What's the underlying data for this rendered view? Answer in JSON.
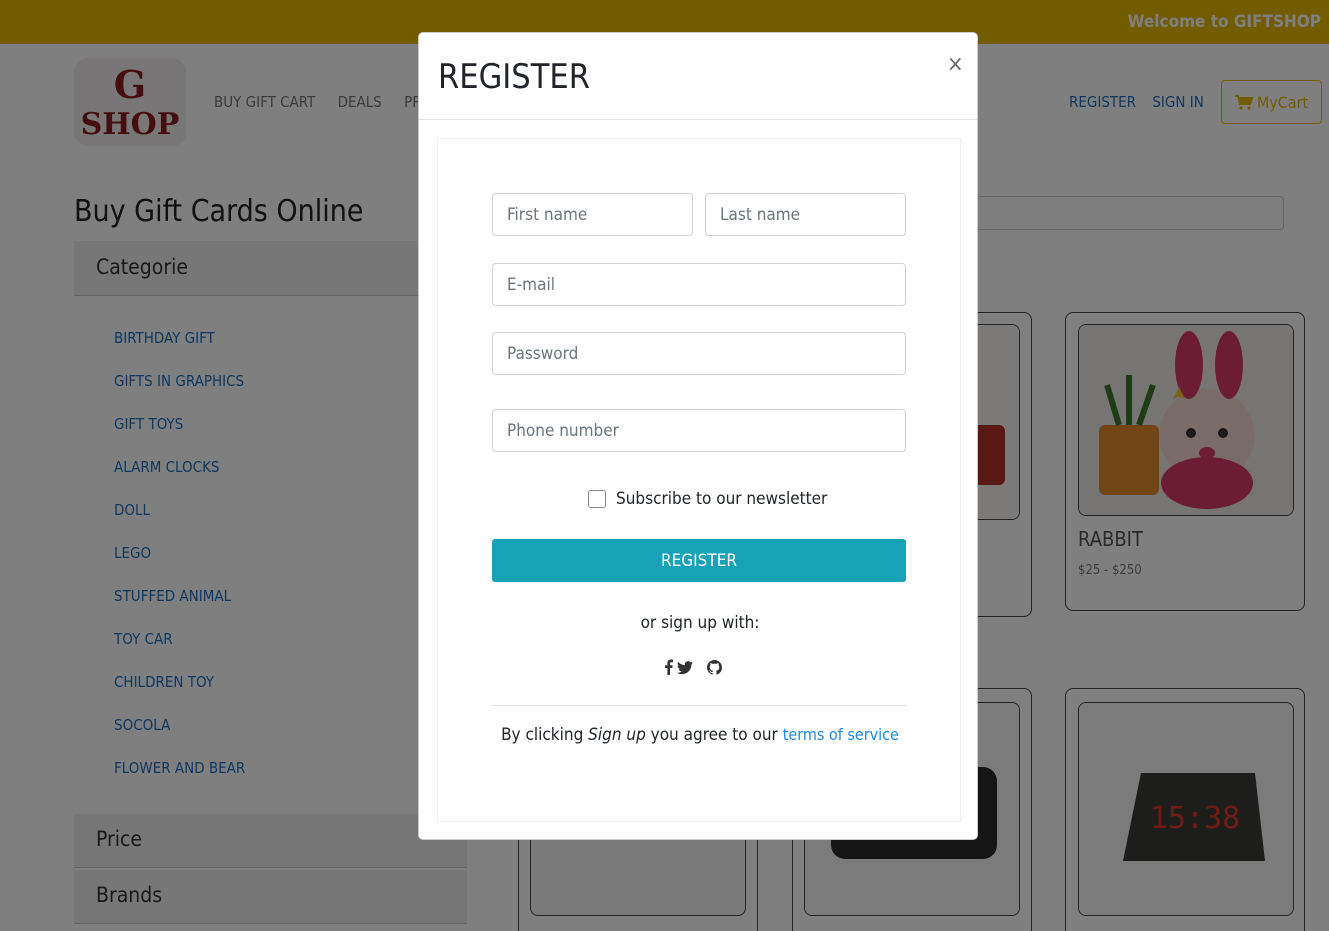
{
  "banner": {
    "welcome": "Welcome to GIFTSHOP"
  },
  "header": {
    "logo_text_top": "G",
    "logo_text_bottom": "SHOP",
    "nav": [
      "BUY GIFT CART",
      "DEALS",
      "PRO"
    ],
    "register": "REGISTER",
    "signin": "SIGN IN",
    "cart": "MyCart"
  },
  "page": {
    "title": "Buy Gift Cards Online",
    "category_header": "Categorie",
    "categories": [
      "BIRTHDAY GIFT",
      "GIFTS IN GRAPHICS",
      "GIFT TOYS",
      "ALARM CLOCKS",
      "DOLL",
      "LEGO",
      "STUFFED ANIMAL",
      "TOY CAR",
      "CHILDREN TOY",
      "SOCOLA",
      "FLOWER AND BEAR"
    ],
    "price_header": "Price",
    "brands_header": "Brands",
    "products": [
      {
        "name": "RABBIT",
        "price": "$25 - $250"
      }
    ]
  },
  "modal": {
    "title": "REGISTER",
    "close": "×",
    "first_name_placeholder": "First name",
    "last_name_placeholder": "Last name",
    "email_placeholder": "E-mail",
    "password_placeholder": "Password",
    "phone_placeholder": "Phone number",
    "newsletter_label": "Subscribe to our newsletter",
    "register_button": "REGISTER",
    "or_signup": "or sign up with:",
    "terms_prefix": "By clicking ",
    "terms_em": "Sign up",
    "terms_middle": " you agree to our ",
    "terms_link": "terms of service"
  },
  "colors": {
    "brand": "#e7b600",
    "link": "#1e6fbf",
    "primary_button": "#17a2b8"
  }
}
